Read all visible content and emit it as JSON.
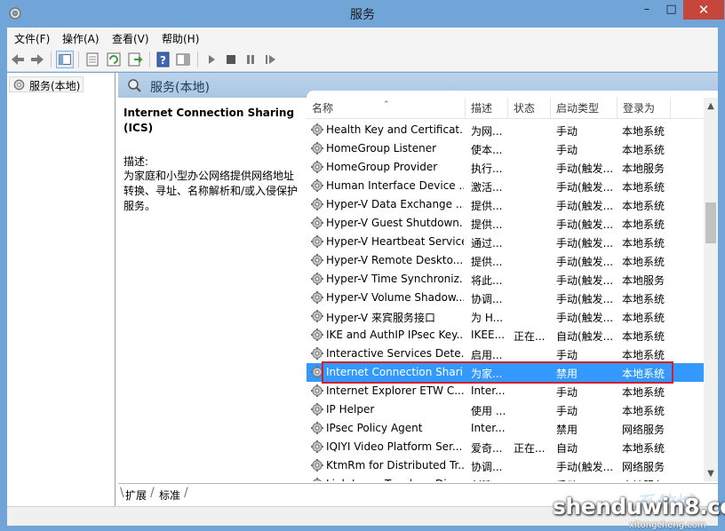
{
  "window": {
    "title": "服务"
  },
  "menu": [
    "文件(F)",
    "操作(A)",
    "查看(V)",
    "帮助(H)"
  ],
  "tree": {
    "root_label": "服务(本地)"
  },
  "pane": {
    "title": "服务(本地)"
  },
  "description": {
    "service_name": "Internet Connection Sharing (ICS)",
    "label": "描述:",
    "text": "为家庭和小型办公网络提供网络地址转换、寻址、名称解析和/或入侵保护服务。"
  },
  "columns": [
    "名称",
    "描述",
    "状态",
    "启动类型",
    "登录为"
  ],
  "rows": [
    {
      "name": "Health Key and Certificat...",
      "desc": "为网...",
      "status": "",
      "startup": "手动",
      "logon": "本地系统"
    },
    {
      "name": "HomeGroup Listener",
      "desc": "使本...",
      "status": "",
      "startup": "手动",
      "logon": "本地系统"
    },
    {
      "name": "HomeGroup Provider",
      "desc": "执行...",
      "status": "",
      "startup": "手动(触发...",
      "logon": "本地服务"
    },
    {
      "name": "Human Interface Device ...",
      "desc": "激活...",
      "status": "",
      "startup": "手动(触发...",
      "logon": "本地系统"
    },
    {
      "name": "Hyper-V Data Exchange ...",
      "desc": "提供...",
      "status": "",
      "startup": "手动(触发...",
      "logon": "本地系统"
    },
    {
      "name": "Hyper-V Guest Shutdown...",
      "desc": "提供...",
      "status": "",
      "startup": "手动(触发...",
      "logon": "本地系统"
    },
    {
      "name": "Hyper-V Heartbeat Service",
      "desc": "通过...",
      "status": "",
      "startup": "手动(触发...",
      "logon": "本地系统"
    },
    {
      "name": "Hyper-V Remote Deskto...",
      "desc": "提供...",
      "status": "",
      "startup": "手动(触发...",
      "logon": "本地系统"
    },
    {
      "name": "Hyper-V Time Synchroniz...",
      "desc": "将此...",
      "status": "",
      "startup": "手动(触发...",
      "logon": "本地服务"
    },
    {
      "name": "Hyper-V Volume Shadow...",
      "desc": "协调...",
      "status": "",
      "startup": "手动(触发...",
      "logon": "本地系统"
    },
    {
      "name": "Hyper-V 来宾服务接口",
      "desc": "为 H...",
      "status": "",
      "startup": "手动(触发...",
      "logon": "本地系统"
    },
    {
      "name": "IKE and AuthIP IPsec Key...",
      "desc": "IKEE...",
      "status": "正在...",
      "startup": "自动(触发...",
      "logon": "本地系统"
    },
    {
      "name": "Interactive Services Dete...",
      "desc": "启用...",
      "status": "",
      "startup": "手动",
      "logon": "本地系统"
    },
    {
      "name": "Internet Connection Shari...",
      "desc": "为家...",
      "status": "",
      "startup": "禁用",
      "logon": "本地系统"
    },
    {
      "name": "Internet Explorer ETW C...",
      "desc": "Inter...",
      "status": "",
      "startup": "手动",
      "logon": "本地系统"
    },
    {
      "name": "IP Helper",
      "desc": "使用 ...",
      "status": "",
      "startup": "手动",
      "logon": "本地系统"
    },
    {
      "name": "IPsec Policy Agent",
      "desc": "Inter...",
      "status": "",
      "startup": "禁用",
      "logon": "网络服务"
    },
    {
      "name": "IQIYI Video Platform Ser...",
      "desc": "爱奇...",
      "status": "正在...",
      "startup": "自动",
      "logon": "本地系统"
    },
    {
      "name": "KtmRm for Distributed Tr...",
      "desc": "协调...",
      "status": "",
      "startup": "手动(触发...",
      "logon": "网络服务"
    },
    {
      "name": "Link-Layer Topology Disc...",
      "desc": "创建...",
      "status": "",
      "startup": "手动",
      "logon": "本地服务"
    }
  ],
  "selected_row": 13,
  "tabs": [
    "扩展",
    "标准"
  ],
  "watermark": {
    "main": "shenduwin8.com",
    "sub": "xitongcheng.com",
    "cn": "系统城"
  },
  "colors": {
    "selection": "#3399ff",
    "highlight_border": "#d4202d",
    "title_bar": "#71a5d8"
  }
}
